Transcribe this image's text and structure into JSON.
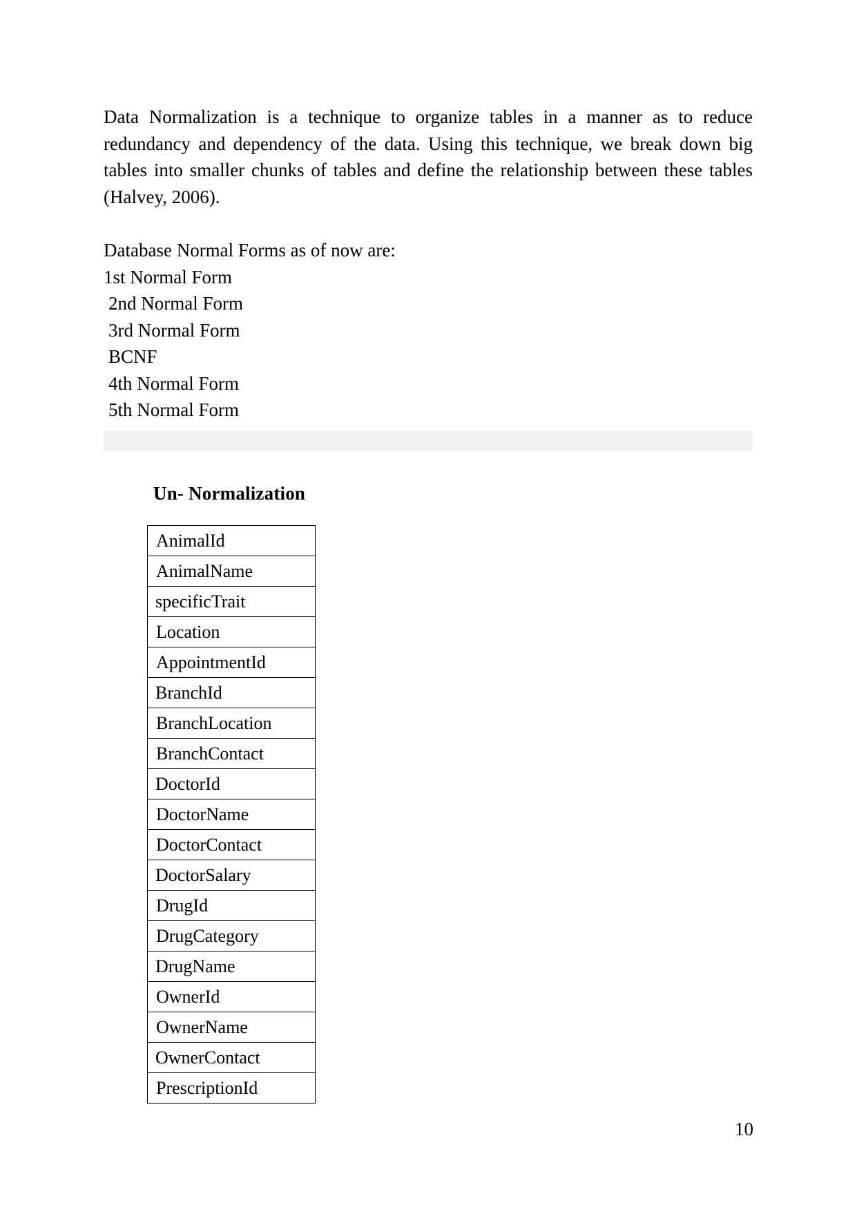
{
  "document": {
    "page_number": "10",
    "intro_paragraph": "Data Normalization is a technique to organize tables in a manner as to reduce redundancy and dependency of the data. Using this technique, we break down big tables into smaller chunks of tables and define the relationship between these tables (Halvey, 2006).",
    "normal_forms": {
      "heading": "Database Normal Forms as of now are:",
      "items": [
        "1st Normal Form",
        "2nd Normal Form",
        "3rd Normal Form",
        "BCNF",
        "4th Normal Form",
        "5th Normal Form"
      ]
    },
    "section": {
      "heading": "Un- Normalization",
      "table": {
        "rows": [
          "AnimalId",
          "AnimalName",
          "specificTrait",
          "Location",
          "AppointmentId",
          "BranchId",
          "BranchLocation",
          "BranchContact",
          "DoctorId",
          "DoctorName",
          "DoctorContact",
          "DoctorSalary",
          "DrugId",
          "DrugCategory",
          "DrugName",
          "OwnerId",
          "OwnerName",
          "OwnerContact",
          "PrescriptionId"
        ]
      }
    },
    "colors": {
      "text": "#000000",
      "page_background": "#ffffff",
      "separator_bar": "#f0f0f0",
      "table_border": "#000000"
    }
  }
}
